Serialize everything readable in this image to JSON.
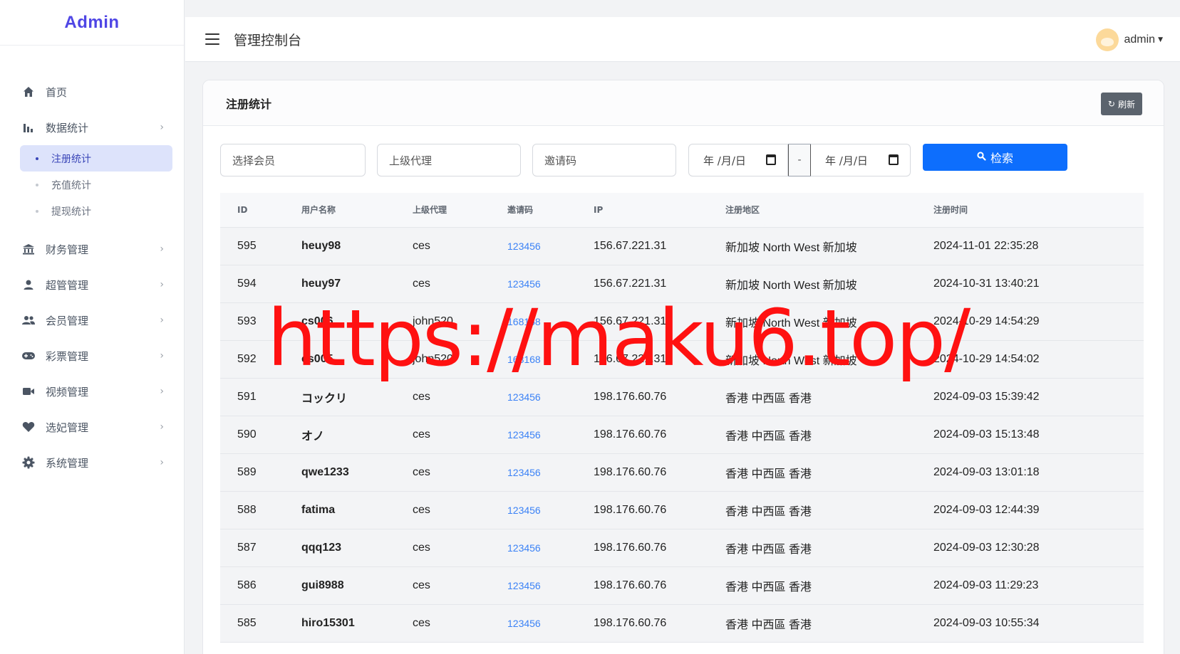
{
  "brand": "Admin",
  "header": {
    "title": "管理控制台",
    "username": "admin"
  },
  "sidebar": {
    "items": [
      {
        "label": "首页",
        "icon": "home-icon"
      },
      {
        "label": "数据统计",
        "icon": "bar-chart-icon",
        "sub": [
          "注册统计",
          "充值统计",
          "提现统计"
        ],
        "active_sub": "注册统计"
      },
      {
        "label": "财务管理",
        "icon": "bank-icon"
      },
      {
        "label": "超管管理",
        "icon": "person-icon"
      },
      {
        "label": "会员管理",
        "icon": "people-icon"
      },
      {
        "label": "彩票管理",
        "icon": "gamepad-icon"
      },
      {
        "label": "视频管理",
        "icon": "video-icon"
      },
      {
        "label": "选妃管理",
        "icon": "heart-icon"
      },
      {
        "label": "系统管理",
        "icon": "gear-icon"
      }
    ]
  },
  "card": {
    "title": "注册统计",
    "refresh_label": "刷新"
  },
  "filters": {
    "member_placeholder": "选择会员",
    "agent_placeholder": "上级代理",
    "invite_placeholder": "邀请码",
    "date_start": "年 /月/日",
    "date_end": "年 /月/日",
    "date_sep": "-",
    "search_label": "检索"
  },
  "table": {
    "columns": [
      "ID",
      "用户名称",
      "上级代理",
      "邀请码",
      "IP",
      "注册地区",
      "注册时间"
    ],
    "rows": [
      [
        "595",
        "heuy98",
        "ces",
        "123456",
        "156.67.221.31",
        "新加坡 North West 新加坡",
        "2024-11-01 22:35:28"
      ],
      [
        "594",
        "heuy97",
        "ces",
        "123456",
        "156.67.221.31",
        "新加坡 North West 新加坡",
        "2024-10-31 13:40:21"
      ],
      [
        "593",
        "cs006",
        "john520",
        "168168",
        "156.67.221.31",
        "新加坡 North West 新加坡",
        "2024-10-29 14:54:29"
      ],
      [
        "592",
        "cs005",
        "john520",
        "168168",
        "156.67.221.31",
        "新加坡 North West 新加坡",
        "2024-10-29 14:54:02"
      ],
      [
        "591",
        "コックリ",
        "ces",
        "123456",
        "198.176.60.76",
        "香港 中西區 香港",
        "2024-09-03 15:39:42"
      ],
      [
        "590",
        "オノ",
        "ces",
        "123456",
        "198.176.60.76",
        "香港 中西區 香港",
        "2024-09-03 15:13:48"
      ],
      [
        "589",
        "qwe1233",
        "ces",
        "123456",
        "198.176.60.76",
        "香港 中西區 香港",
        "2024-09-03 13:01:18"
      ],
      [
        "588",
        "fatima",
        "ces",
        "123456",
        "198.176.60.76",
        "香港 中西區 香港",
        "2024-09-03 12:44:39"
      ],
      [
        "587",
        "qqq123",
        "ces",
        "123456",
        "198.176.60.76",
        "香港 中西區 香港",
        "2024-09-03 12:30:28"
      ],
      [
        "586",
        "gui8988",
        "ces",
        "123456",
        "198.176.60.76",
        "香港 中西區 香港",
        "2024-09-03 11:29:23"
      ],
      [
        "585",
        "hiro15301",
        "ces",
        "123456",
        "198.176.60.76",
        "香港 中西區 香港",
        "2024-09-03 10:55:34"
      ]
    ]
  },
  "watermark": "https://maku6.top/",
  "colors": {
    "brand": "#4f46e5",
    "primary": "#0d6efd",
    "refresh": "#5b636d",
    "active_bg": "#dde3fb",
    "link": "#3b82f6",
    "watermark": "#ff1111"
  }
}
